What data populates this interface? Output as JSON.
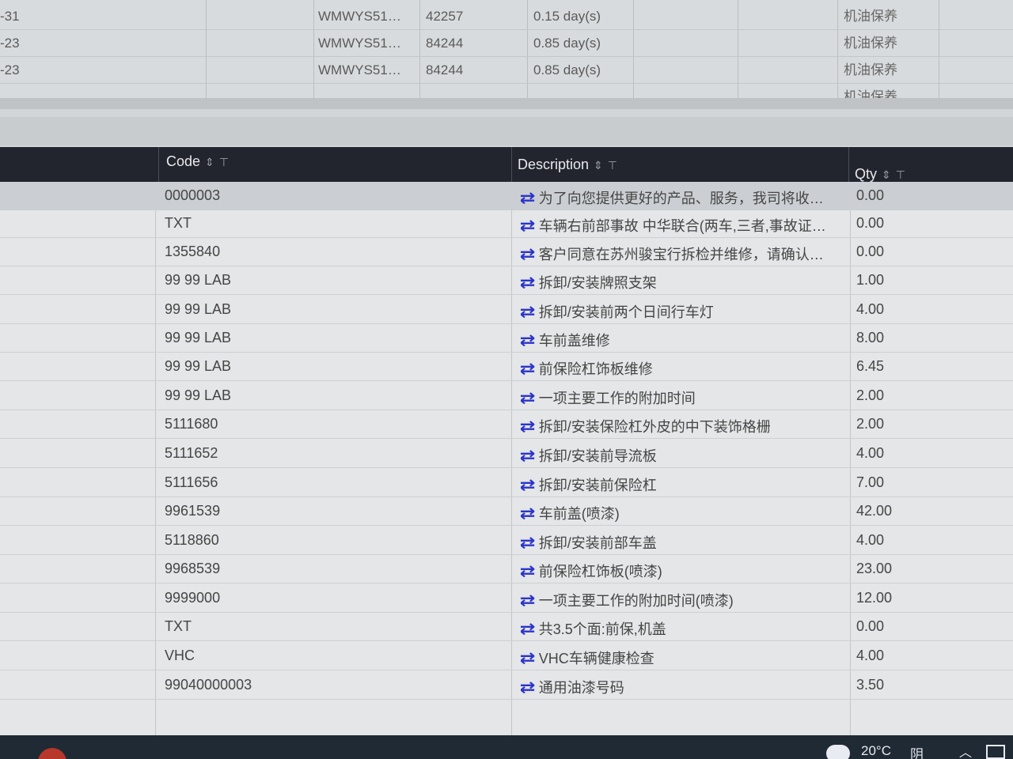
{
  "top_grid": {
    "rows": [
      {
        "date": "-31",
        "vin": "WMWYS51…",
        "mileage": "42257",
        "duration": "0.15 day(s)",
        "type": "机油保养"
      },
      {
        "date": "-23",
        "vin": "WMWYS51…",
        "mileage": "84244",
        "duration": "0.85 day(s)",
        "type": "机油保养"
      },
      {
        "date": "-23",
        "vin": "WMWYS51…",
        "mileage": "84244",
        "duration": "0.85 day(s)",
        "type": "机油保养"
      },
      {
        "date": "",
        "vin": "",
        "mileage": "",
        "duration": "",
        "type": "机油保养"
      }
    ]
  },
  "table": {
    "columns": {
      "code": "Code",
      "description": "Description",
      "qty": "Qty"
    },
    "rows": [
      {
        "code": "0000003",
        "description": "为了向您提供更好的产品、服务，我司将收集…",
        "qty": "0.00"
      },
      {
        "code": "TXT",
        "description": "车辆右前部事故 中华联合(两车,三者,事故证明…",
        "qty": "0.00"
      },
      {
        "code": "1355840",
        "description": "客户同意在苏州骏宝行拆检并维修，请确认后…",
        "qty": "0.00"
      },
      {
        "code": "99 99 LAB",
        "description": "拆卸/安装牌照支架",
        "qty": "1.00"
      },
      {
        "code": "99 99 LAB",
        "description": "拆卸/安装前两个日间行车灯",
        "qty": "4.00"
      },
      {
        "code": "99 99 LAB",
        "description": "车前盖维修",
        "qty": "8.00"
      },
      {
        "code": "99 99 LAB",
        "description": "前保险杠饰板维修",
        "qty": "6.45"
      },
      {
        "code": "99 99 LAB",
        "description": "一项主要工作的附加时间",
        "qty": "2.00"
      },
      {
        "code": "5111680",
        "description": "拆卸/安装保险杠外皮的中下装饰格栅",
        "qty": "2.00"
      },
      {
        "code": "5111652",
        "description": "拆卸/安装前导流板",
        "qty": "4.00"
      },
      {
        "code": "5111656",
        "description": "拆卸/安装前保险杠",
        "qty": "7.00"
      },
      {
        "code": "9961539",
        "description": "车前盖(喷漆)",
        "qty": "42.00"
      },
      {
        "code": "5118860",
        "description": "拆卸/安装前部车盖",
        "qty": "4.00"
      },
      {
        "code": "9968539",
        "description": "前保险杠饰板(喷漆)",
        "qty": "23.00"
      },
      {
        "code": "9999000",
        "description": "一项主要工作的附加时间(喷漆)",
        "qty": "12.00"
      },
      {
        "code": "TXT",
        "description": "共3.5个面:前保,机盖",
        "qty": "0.00"
      },
      {
        "code": "VHC",
        "description": "VHC车辆健康检查",
        "qty": "4.00"
      },
      {
        "code": "99040000003",
        "description": "通用油漆号码",
        "qty": "3.50"
      }
    ]
  },
  "icons": {
    "sort": "⇕",
    "filter": "⊤",
    "row_action": "⇄"
  },
  "taskbar": {
    "temperature": "20°C",
    "condition": "阴"
  },
  "colors": {
    "header_bg": "#23252e",
    "row_icon": "#2b34c9",
    "selected_row": "#cbcfd3"
  }
}
